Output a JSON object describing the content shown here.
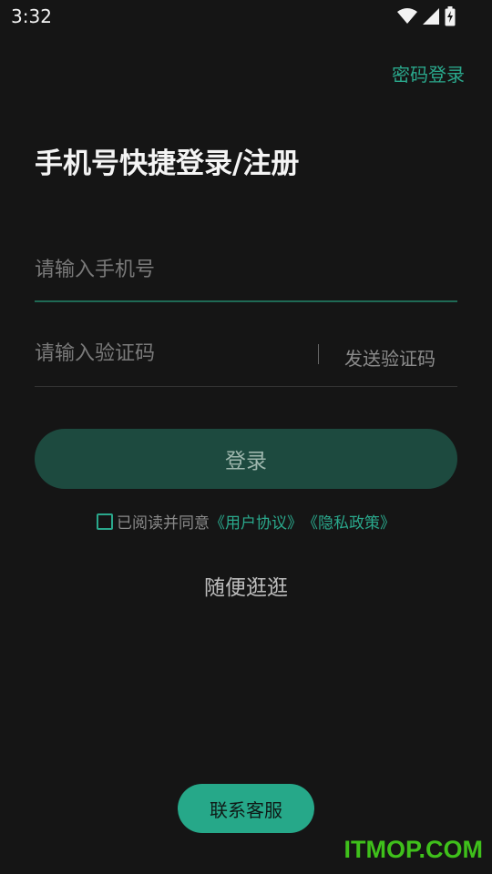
{
  "status_bar": {
    "time": "3:32",
    "icons": [
      "wifi-icon",
      "cellular-signal-icon",
      "battery-charging-icon"
    ]
  },
  "header": {
    "password_login": "密码登录",
    "title": "手机号快捷登录/注册"
  },
  "form": {
    "phone_placeholder": "请输入手机号",
    "code_placeholder": "请输入验证码",
    "send_code": "发送验证码",
    "login_button": "登录"
  },
  "agreement": {
    "text": "已阅读并同意",
    "user_agreement": "《用户协议》",
    "privacy_policy": "《隐私政策》"
  },
  "browse_link": "随便逛逛",
  "contact_button": "联系客服",
  "watermark": "ITMOP.COM",
  "colors": {
    "background": "#151515",
    "accent": "#2aa88c",
    "login_button_bg": "#1d4a3f",
    "contact_button_bg": "#26a889",
    "watermark": "#3fc01b"
  }
}
